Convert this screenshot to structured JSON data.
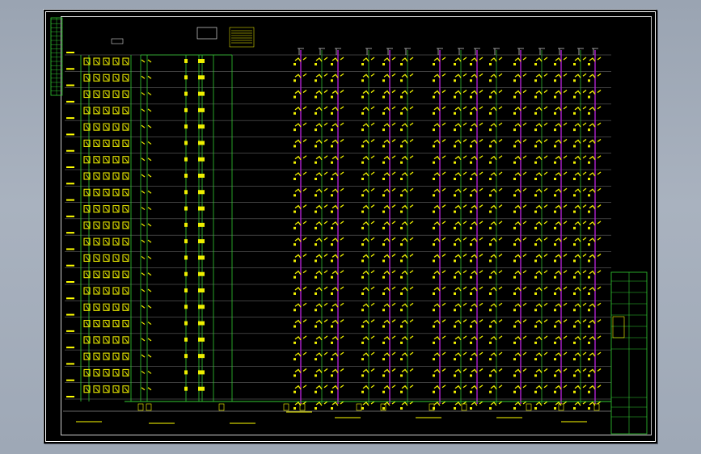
{
  "viewport": {
    "background_color": "#a3acb9",
    "sheet_color": "#000000"
  },
  "drawing": {
    "colors": {
      "border": "#ffffff",
      "riser_green": "#33cc33",
      "riser_purple": "#b020d0",
      "floor_line": "#dddddd",
      "annotation_yellow": "#ffff00",
      "sprinkler_yellow": "#eeee00"
    },
    "floor_count": 22
  }
}
